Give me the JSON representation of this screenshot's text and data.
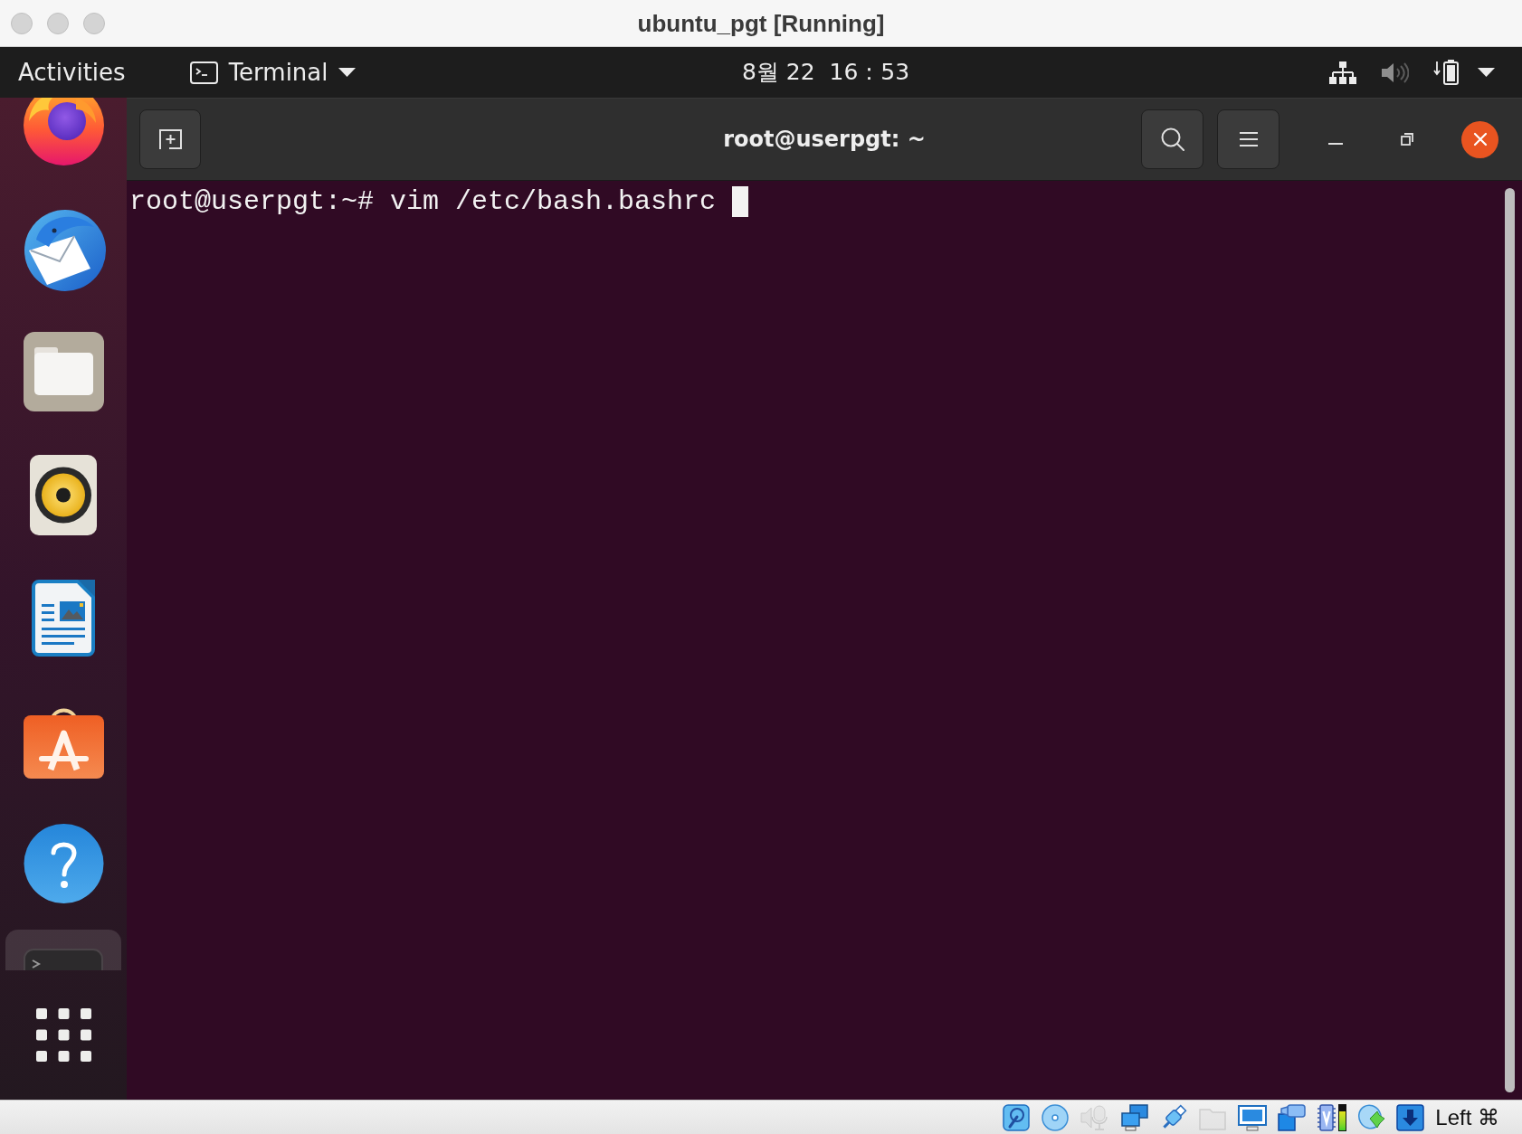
{
  "host_window": {
    "title": "ubuntu_pgt [Running]"
  },
  "top_bar": {
    "activities": "Activities",
    "app_menu": {
      "label": "Terminal"
    },
    "clock": "8월 22  16：53",
    "sound": {
      "muted": true
    }
  },
  "dock": {
    "items": [
      {
        "kind": "browser",
        "selected": false
      },
      {
        "kind": "mail",
        "selected": false
      },
      {
        "kind": "files",
        "selected": false
      },
      {
        "kind": "music",
        "selected": false
      },
      {
        "kind": "writer",
        "selected": false
      },
      {
        "kind": "store",
        "selected": false
      },
      {
        "kind": "help",
        "selected": false
      },
      {
        "kind": "terminal",
        "selected": true
      }
    ]
  },
  "terminal": {
    "title": "root@userpgt: ~",
    "lines": [
      "root@userpgt:~# vim /etc/bash.bashrc"
    ]
  },
  "status_bar": {
    "indicators": [
      {
        "kind": "disk",
        "disabled": false
      },
      {
        "kind": "optical",
        "disabled": false
      },
      {
        "kind": "audio",
        "disabled": true
      },
      {
        "kind": "network",
        "disabled": false
      },
      {
        "kind": "usb",
        "disabled": false
      },
      {
        "kind": "folders",
        "disabled": true
      },
      {
        "kind": "display",
        "disabled": false
      },
      {
        "kind": "capture",
        "disabled": false
      },
      {
        "kind": "processor",
        "disabled": false
      },
      {
        "kind": "load",
        "disabled": false,
        "level": 0.72
      },
      {
        "kind": "mouse",
        "disabled": false
      },
      {
        "kind": "keyboard",
        "disabled": false
      }
    ],
    "host_key": "Left ⌘"
  }
}
